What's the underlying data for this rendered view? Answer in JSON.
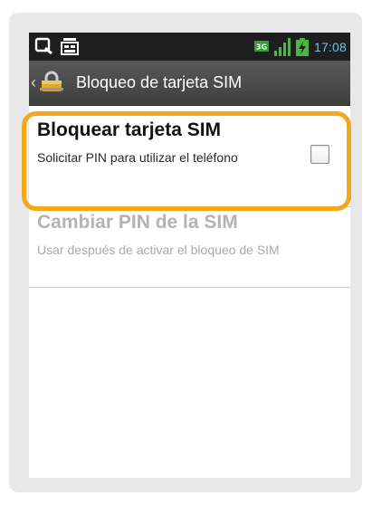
{
  "status_bar": {
    "left_icons": [
      "search-icon",
      "sim-toolkit-icon"
    ],
    "network_badge": "3G",
    "right_icons": [
      "signal-bars-icon",
      "battery-charging-icon"
    ],
    "time": "17:08"
  },
  "action_bar": {
    "title": "Bloqueo de tarjeta SIM",
    "back_icon": "back-chevron-icon",
    "app_icon": "padlock-icon"
  },
  "preferences": [
    {
      "title": "Bloquear tarjeta SIM",
      "summary": "Solicitar PIN para utilizar el teléfono",
      "enabled": true,
      "checked": false
    },
    {
      "title": "Cambiar PIN de la SIM",
      "summary": "Usar después de activar el bloqueo de SIM",
      "enabled": false
    }
  ],
  "highlight_color": "#f2a81a"
}
